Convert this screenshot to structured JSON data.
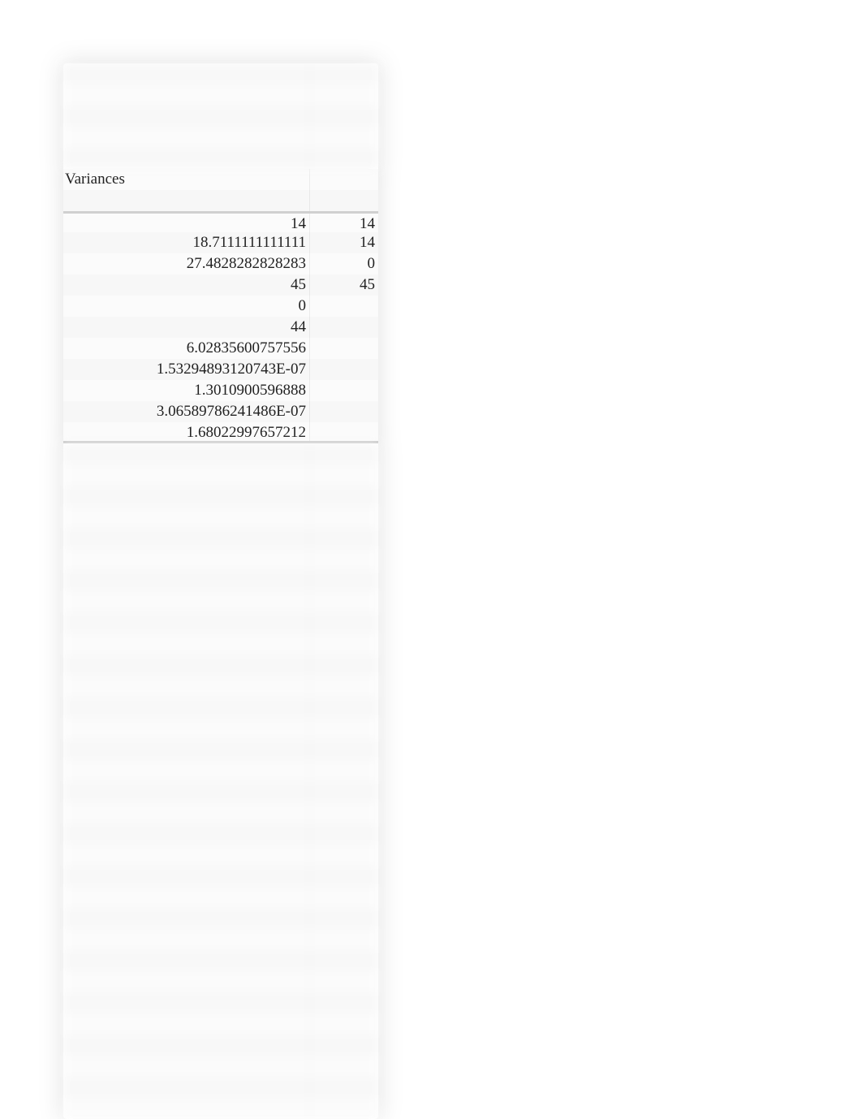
{
  "label": "Variances",
  "leading_blank_rows": 5,
  "trailing_blank_rows": 32,
  "data_rows": [
    {
      "col1": "14",
      "col2": "14"
    },
    {
      "col1": "18.7111111111111",
      "col2": "14"
    },
    {
      "col1": "27.4828282828283",
      "col2": "0"
    },
    {
      "col1": "45",
      "col2": "45"
    },
    {
      "col1": "0",
      "col2": ""
    },
    {
      "col1": "44",
      "col2": ""
    },
    {
      "col1": "6.02835600757556",
      "col2": ""
    },
    {
      "col1": "1.53294893120743E-07",
      "col2": ""
    },
    {
      "col1": "1.3010900596888",
      "col2": ""
    },
    {
      "col1": "3.06589786241486E-07",
      "col2": ""
    },
    {
      "col1": "1.68022997657212",
      "col2": ""
    }
  ]
}
